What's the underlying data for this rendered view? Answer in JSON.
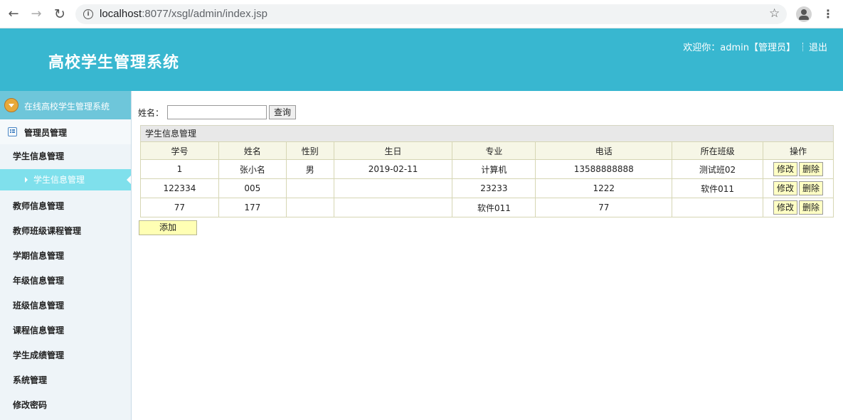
{
  "browser": {
    "url_host": "localhost",
    "url_path": ":8077/xsgl/admin/index.jsp"
  },
  "header": {
    "title": "高校学生管理系统",
    "welcome": "欢迎你：admin【管理员】",
    "logout": "退出"
  },
  "sidebar": {
    "top_label": "在线高校学生管理系统",
    "group_label": "管理员管理",
    "items": [
      {
        "label": "学生信息管理"
      },
      {
        "label": "教师信息管理"
      },
      {
        "label": "教师班级课程管理"
      },
      {
        "label": "学期信息管理"
      },
      {
        "label": "年级信息管理"
      },
      {
        "label": "班级信息管理"
      },
      {
        "label": "课程信息管理"
      },
      {
        "label": "学生成绩管理"
      },
      {
        "label": "系统管理"
      },
      {
        "label": "修改密码"
      }
    ],
    "active_sub": "学生信息管理"
  },
  "search": {
    "label": "姓名：",
    "value": "",
    "button": "查询"
  },
  "table": {
    "caption": "学生信息管理",
    "headers": [
      "学号",
      "姓名",
      "性别",
      "生日",
      "专业",
      "电话",
      "所在班级",
      "操作"
    ],
    "rows": [
      [
        "1",
        "张小名",
        "男",
        "2019-02-11",
        "计算机",
        "13588888888",
        "测试班02"
      ],
      [
        "122334",
        "005",
        "",
        "",
        "23233",
        "1222",
        "软件011"
      ],
      [
        "77",
        "177",
        "",
        "",
        "软件011",
        "77",
        ""
      ]
    ],
    "edit_label": "修改",
    "delete_label": "删除"
  },
  "add_button": "添加"
}
